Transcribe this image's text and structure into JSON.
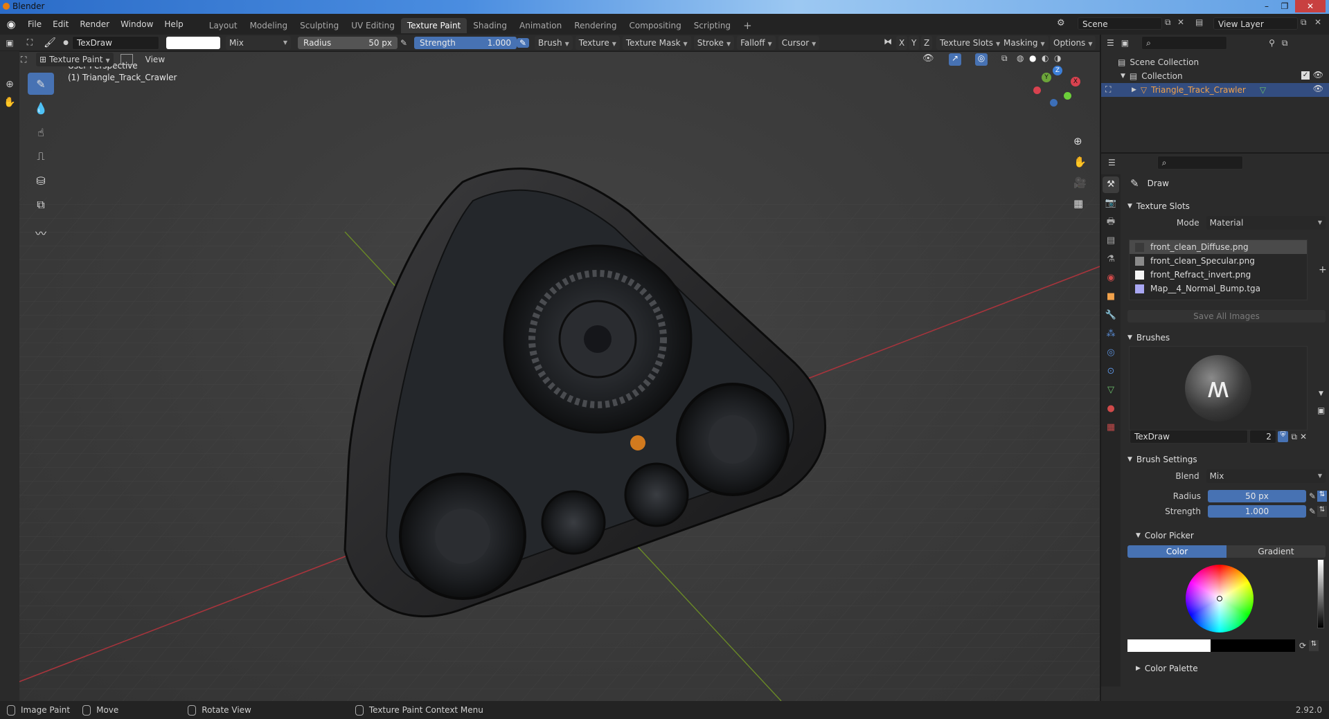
{
  "window": {
    "title": "Blender"
  },
  "menu": {
    "items": [
      "File",
      "Edit",
      "Render",
      "Window",
      "Help"
    ],
    "workspaces": [
      "Layout",
      "Modeling",
      "Sculpting",
      "UV Editing",
      "Texture Paint",
      "Shading",
      "Animation",
      "Rendering",
      "Compositing",
      "Scripting"
    ],
    "active_workspace": "Texture Paint",
    "add_tab": "+",
    "scene": "Scene",
    "view_layer": "View Layer"
  },
  "toolheader": {
    "brush_name": "TexDraw",
    "blend": "Mix",
    "radius_label": "Radius",
    "radius_value": "50 px",
    "strength_label": "Strength",
    "strength_value": "1.000",
    "menus": [
      "Brush",
      "Texture",
      "Texture Mask",
      "Stroke",
      "Falloff",
      "Cursor"
    ],
    "axes": [
      "X",
      "Y",
      "Z"
    ],
    "right_menus": [
      "Texture Slots",
      "Masking",
      "Options"
    ]
  },
  "header2": {
    "mode": "Texture Paint",
    "view": "View"
  },
  "viewport": {
    "perspective": "User Perspective",
    "object": "(1) Triangle_Track_Crawler",
    "gizmo": {
      "x": "X",
      "y": "Y",
      "z": "Z"
    }
  },
  "outliner": {
    "root": "Scene Collection",
    "collection": "Collection",
    "object": "Triangle_Track_Crawler"
  },
  "properties": {
    "tool_name": "Draw",
    "texture_slots": {
      "title": "Texture Slots",
      "mode_label": "Mode",
      "mode_value": "Material",
      "slots": [
        {
          "name": "front_clean_Diffuse.png",
          "color": "#3a3a3a"
        },
        {
          "name": "front_clean_Specular.png",
          "color": "#8a8a8a"
        },
        {
          "name": "front_Refract_invert.png",
          "color": "#f5f5f5"
        },
        {
          "name": "Map__4_Normal_Bump.tga",
          "color": "#a9a7f2"
        }
      ],
      "save_all": "Save All Images"
    },
    "brushes": {
      "title": "Brushes",
      "brush_name": "TexDraw",
      "users": "2"
    },
    "brush_settings": {
      "title": "Brush Settings",
      "blend_label": "Blend",
      "blend_value": "Mix",
      "radius_label": "Radius",
      "radius_value": "50 px",
      "strength_label": "Strength",
      "strength_value": "1.000"
    },
    "color_picker": {
      "title": "Color Picker",
      "tab_color": "Color",
      "tab_gradient": "Gradient"
    },
    "color_palette": {
      "title": "Color Palette"
    }
  },
  "statusbar": {
    "items": [
      "Image Paint",
      "Move",
      "Rotate View",
      "Texture Paint Context Menu"
    ],
    "version": "2.92.0"
  },
  "colors": {
    "accent": "#4772b3",
    "selected_object": "#f2a24b",
    "axis_x": "#c23a44",
    "axis_y": "#6a9a2a"
  }
}
